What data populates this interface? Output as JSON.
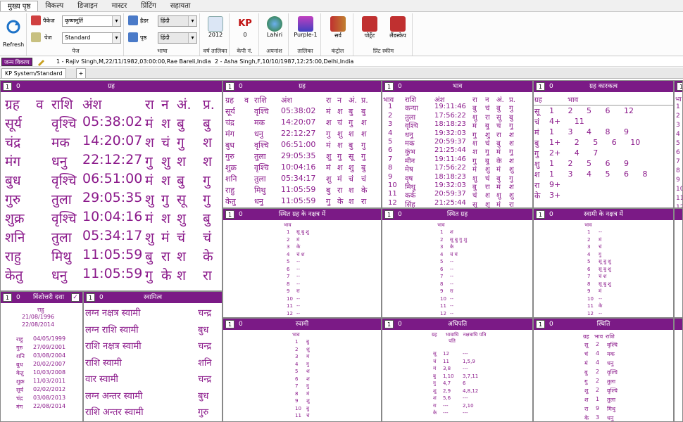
{
  "menu": [
    "मुख्य पृष्ठ",
    "विकल्प",
    "डिजाइन",
    "मास्टर",
    "प्रिंटिंग",
    "सहायता"
  ],
  "ribbon": {
    "refresh": "Refresh",
    "package_label": "पैकेज",
    "package_value": "कृष्णमूर्ति",
    "page_label": "पेज",
    "page_value": "Standard",
    "group_page": "पेज",
    "chart_label": "हैडर",
    "chart_value": "हिंदी",
    "pagelang_label": "पृष्ठ",
    "pagelang_value": "हिंदी",
    "group_lang": "भाषा",
    "year": "2012",
    "group_year": "वर्ष तालिका",
    "kp": "KP",
    "kp_num": "0",
    "group_kp": "केपी नं.",
    "lahiri": "Lahiri",
    "group_ayan": "अयनांश",
    "purple": "Purple-1",
    "group_table": "तालिका",
    "sarv": "सर्व",
    "group_control": "कंट्रोल",
    "portrait": "पोर्ट्रेट",
    "landscape": "लैंडस्केप",
    "group_print": "प्रिंट स्कीम"
  },
  "charts": {
    "btn": "जन्म विवरण",
    "c1": "1 - Rajiv Singh,M,22/11/1982,03:00:00,Rae Bareli,India",
    "c2": "2 - Asha Singh,F,10/10/1987,12:25:00,Delhi,India"
  },
  "tabs": {
    "kp": "KP System/Standard",
    "plus": "+"
  },
  "p1": {
    "n": "1",
    "z": "0",
    "title": "ग्रह",
    "header": [
      "ग्रह",
      "व",
      "राशि",
      "अंश",
      "रा",
      "न",
      "अं.",
      "प्र."
    ],
    "rows": [
      [
        "सूर्य",
        "",
        "वृश्चि",
        "05:38:02",
        "मं",
        "श",
        "बु",
        "बु"
      ],
      [
        "चंद्र",
        "",
        "मक",
        "14:20:07",
        "श",
        "चं",
        "गु",
        "श"
      ],
      [
        "मंग",
        "",
        "धनु",
        "22:12:27",
        "गु",
        "शु",
        "श",
        "श"
      ],
      [
        "बुध",
        "",
        "वृश्चि",
        "06:51:00",
        "मं",
        "श",
        "बु",
        "गु"
      ],
      [
        "गुरु",
        "",
        "तुला",
        "29:05:35",
        "शु",
        "गु",
        "सू",
        "गु"
      ],
      [
        "शुक्र",
        "",
        "वृश्चि",
        "10:04:16",
        "मं",
        "श",
        "शु",
        "बु"
      ],
      [
        "शनि",
        "",
        "तुला",
        "05:34:17",
        "शु",
        "मं",
        "चं",
        "चं"
      ],
      [
        "राहु",
        "",
        "मिथु",
        "11:05:59",
        "बु",
        "रा",
        "श",
        "के"
      ],
      [
        "केतु",
        "",
        "धनु",
        "11:05:59",
        "गु",
        "के",
        "श",
        "रा"
      ]
    ]
  },
  "p2": {
    "n": "1",
    "z": "0",
    "title": "ग्रह",
    "header": [
      "ग्रह",
      "व",
      "राशि",
      "अंश",
      "रा",
      "न",
      "अं.",
      "प्र."
    ],
    "rows": [
      [
        "सूर्य",
        "",
        "वृश्चि",
        "05:38:02",
        "मं",
        "श",
        "बु",
        "बु"
      ],
      [
        "चंद्र",
        "",
        "मक",
        "14:20:07",
        "श",
        "चं",
        "गु",
        "श"
      ],
      [
        "मंग",
        "",
        "धनु",
        "22:12:27",
        "गु",
        "शु",
        "श",
        "श"
      ],
      [
        "बुध",
        "",
        "वृश्चि",
        "06:51:00",
        "मं",
        "श",
        "बु",
        "गु"
      ],
      [
        "गुरु",
        "",
        "तुला",
        "29:05:35",
        "शु",
        "गु",
        "सू",
        "गु"
      ],
      [
        "शुक्र",
        "",
        "वृश्चि",
        "10:04:16",
        "मं",
        "श",
        "शु",
        "बु"
      ],
      [
        "शनि",
        "",
        "तुला",
        "05:34:17",
        "शु",
        "मं",
        "चं",
        "चं"
      ],
      [
        "राहु",
        "",
        "मिथु",
        "11:05:59",
        "बु",
        "रा",
        "श",
        "के"
      ],
      [
        "केतु",
        "",
        "धनु",
        "11:05:59",
        "गु",
        "के",
        "श",
        "रा"
      ]
    ]
  },
  "p3": {
    "n": "1",
    "z": "0",
    "title": "भाव",
    "header": [
      "भाव",
      "राशि",
      "अंश",
      "रा",
      "न",
      "अं.",
      "प्र."
    ],
    "rows": [
      [
        "1",
        "कन्या",
        "19:11:46",
        "बु",
        "चं",
        "बु",
        "गु"
      ],
      [
        "2",
        "तुला",
        "17:56:22",
        "शु",
        "रा",
        "सू",
        "बु"
      ],
      [
        "3",
        "वृश्चि",
        "18:18:23",
        "मं",
        "बु",
        "चं",
        "गु"
      ],
      [
        "4",
        "धनु",
        "19:32:03",
        "गु",
        "शु",
        "रा",
        "श"
      ],
      [
        "5",
        "मक",
        "20:59:37",
        "श",
        "चं",
        "बु",
        "श"
      ],
      [
        "6",
        "कुंभ",
        "21:25:44",
        "श",
        "गु",
        "मं",
        "गु"
      ],
      [
        "7",
        "मीन",
        "19:11:46",
        "गु",
        "बु",
        "के",
        "श"
      ],
      [
        "8",
        "मेष",
        "17:56:22",
        "मं",
        "शु",
        "मं",
        "शु"
      ],
      [
        "9",
        "वृष",
        "18:18:23",
        "शु",
        "चं",
        "बु",
        "गु"
      ],
      [
        "10",
        "मिथु",
        "19:32:03",
        "बु",
        "रा",
        "मं",
        "श"
      ],
      [
        "11",
        "कर्क",
        "20:59:37",
        "चं",
        "श",
        "शु",
        "शु"
      ],
      [
        "12",
        "सिंह",
        "21:25:44",
        "सू",
        "शु",
        "मं",
        "रा"
      ]
    ]
  },
  "p4": {
    "n": "1",
    "z": "0",
    "title": "ग्रह कारकत्व",
    "head": [
      "ग्रह",
      "भाव"
    ],
    "rows": [
      [
        "सू",
        "1 2 5 6 12"
      ],
      [
        "चं",
        "4+ 11"
      ],
      [
        "मं",
        "1 3 4 8 9"
      ],
      [
        "बु",
        "1+ 2 5 6 10"
      ],
      [
        "गु",
        "2+ 4 7"
      ],
      [
        "शु",
        "1 2 5 6 9"
      ],
      [
        "श",
        "1 3 4 5 6 8"
      ],
      [
        "रा",
        "9+"
      ],
      [
        "के",
        "3+"
      ]
    ]
  },
  "p4b": {
    "n": "1",
    "head": "भा",
    "rows": [
      "1",
      "2",
      "3",
      "4",
      "5",
      "6",
      "7",
      "8",
      "9",
      "10",
      "11",
      "12"
    ]
  },
  "p5": {
    "n": "1",
    "z": "0",
    "title": "स्थित ग्रह के नक्षत्र में",
    "head": "भाव",
    "rows": [
      [
        "1",
        "सू बु शु"
      ],
      [
        "2",
        "मं"
      ],
      [
        "3",
        "के"
      ],
      [
        "4",
        "चं श"
      ],
      [
        "5",
        "--"
      ],
      [
        "6",
        "--"
      ],
      [
        "7",
        "--"
      ],
      [
        "8",
        "--"
      ],
      [
        "9",
        "रा"
      ],
      [
        "10",
        "--"
      ],
      [
        "11",
        "--"
      ],
      [
        "12",
        "--"
      ]
    ]
  },
  "p6": {
    "n": "1",
    "z": "0",
    "title": "स्थित ग्रह",
    "head": "भाव",
    "rows": [
      [
        "1",
        "श"
      ],
      [
        "2",
        "सू बु गु शु"
      ],
      [
        "3",
        "के"
      ],
      [
        "4",
        "चं मं"
      ],
      [
        "5",
        "--"
      ],
      [
        "6",
        "--"
      ],
      [
        "7",
        "--"
      ],
      [
        "8",
        "--"
      ],
      [
        "9",
        "रा"
      ],
      [
        "10",
        "--"
      ],
      [
        "11",
        "--"
      ],
      [
        "12",
        "--"
      ]
    ]
  },
  "p7": {
    "n": "1",
    "z": "0",
    "title": "स्वामी के नक्षत्र में",
    "head": "भाव",
    "rows": [
      [
        "1",
        "--"
      ],
      [
        "2",
        "मं"
      ],
      [
        "3",
        "चं"
      ],
      [
        "4",
        "गु"
      ],
      [
        "5",
        "सू बु शु"
      ],
      [
        "6",
        "सू बु शु"
      ],
      [
        "7",
        "चं श"
      ],
      [
        "8",
        "सू बु शु"
      ],
      [
        "9",
        "मं"
      ],
      [
        "10",
        "--"
      ],
      [
        "11",
        "के"
      ],
      [
        "12",
        "--"
      ]
    ]
  },
  "p8": {
    "n": "1",
    "z": "0",
    "title": "विंशोत्तरी दशा",
    "top": [
      "राहु",
      "21/08/1996",
      "22/08/2014"
    ],
    "rows": [
      [
        "राहु",
        "04/05/1999"
      ],
      [
        "गुरु",
        "27/09/2001"
      ],
      [
        "शनि",
        "03/08/2004"
      ],
      [
        "बुध",
        "20/02/2007"
      ],
      [
        "केतु",
        "10/03/2008"
      ],
      [
        "शुक्र",
        "11/03/2011"
      ],
      [
        "सूर्य",
        "02/02/2012"
      ],
      [
        "चंद्र",
        "03/08/2013"
      ],
      [
        "मंग",
        "22/08/2014"
      ]
    ]
  },
  "p9": {
    "n": "1",
    "z": "0",
    "title": "स्वामित्व",
    "rows": [
      [
        "लग्न नक्षत्र स्वामी",
        "चन्द्र"
      ],
      [
        "लग्न राशि स्वामी",
        "बुध"
      ],
      [
        "राशि नक्षत्र स्वामी",
        "चन्द्र"
      ],
      [
        "राशि स्वामी",
        "शनि"
      ],
      [
        "वार स्वामी",
        "चन्द्र"
      ],
      [
        "लग्न अन्तर स्वामी",
        "बुध"
      ],
      [
        "राशि अन्तर स्वामी",
        "गुरु"
      ]
    ]
  },
  "p10": {
    "n": "1",
    "z": "0",
    "title": "स्वामी",
    "head": "भाव",
    "rows": [
      [
        "1",
        "बु"
      ],
      [
        "2",
        "शु"
      ],
      [
        "3",
        "मं"
      ],
      [
        "4",
        "गु"
      ],
      [
        "5",
        "श"
      ],
      [
        "6",
        "श"
      ],
      [
        "7",
        "गु"
      ],
      [
        "8",
        "मं"
      ],
      [
        "9",
        "शु"
      ],
      [
        "10",
        "बु"
      ],
      [
        "11",
        "चं"
      ],
      [
        "12",
        "सू"
      ]
    ]
  },
  "p11": {
    "n": "1",
    "z": "0",
    "title": "अधिपति",
    "head": [
      "ग्रह",
      "भावाधि पति",
      "नक्षत्राधि पति"
    ],
    "rows": [
      [
        "सू",
        "12",
        "---"
      ],
      [
        "चं",
        "11",
        "1,5,9"
      ],
      [
        "मं",
        "3,8",
        "---"
      ],
      [
        "बु",
        "1,10",
        "3,7,11"
      ],
      [
        "गु",
        "4,7",
        "6"
      ],
      [
        "शु",
        "2,9",
        "4,8,12"
      ],
      [
        "श",
        "5,6",
        "---"
      ],
      [
        "रा",
        "---",
        "2,10"
      ],
      [
        "के",
        "---",
        "---"
      ]
    ]
  },
  "p12": {
    "n": "1",
    "z": "0",
    "title": "स्थिति",
    "head": [
      "ग्रह",
      "भाव",
      "राशि"
    ],
    "rows": [
      [
        "सू",
        "2",
        "वृश्चि"
      ],
      [
        "चं",
        "4",
        "मक"
      ],
      [
        "मं",
        "4",
        "धनु"
      ],
      [
        "बु",
        "2",
        "वृश्चि"
      ],
      [
        "गु",
        "2",
        "तुला"
      ],
      [
        "शु",
        "2",
        "वृश्चि"
      ],
      [
        "श",
        "1",
        "तुला"
      ],
      [
        "रा",
        "9",
        "मिथु"
      ],
      [
        "के",
        "3",
        "धनु"
      ]
    ]
  },
  "right_edge": [
    "ग्रह",
    "1",
    "2",
    "3",
    "4",
    "5",
    "6",
    "7",
    "8",
    "9",
    "10",
    "11",
    "12"
  ]
}
